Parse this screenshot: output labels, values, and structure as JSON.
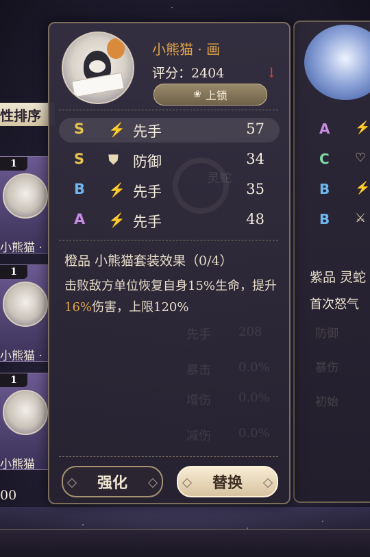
{
  "popup": {
    "title": "小熊猫 · 画",
    "score_label": "评分：2404",
    "lock_label": "上锁",
    "stats": [
      {
        "grade": "S",
        "grade_color": "#e7c44e",
        "icon": "speed-icon",
        "glyph": "⚡",
        "name": "先手",
        "value": "57",
        "highlight": true
      },
      {
        "grade": "S",
        "grade_color": "#e7c44e",
        "icon": "shield-icon",
        "glyph": "⛊",
        "name": "防御",
        "value": "34",
        "highlight": false
      },
      {
        "grade": "B",
        "grade_color": "#6fb6ee",
        "icon": "speed-icon",
        "glyph": "⚡",
        "name": "先手",
        "value": "35",
        "highlight": false
      },
      {
        "grade": "A",
        "grade_color": "#c98be3",
        "icon": "speed-icon",
        "glyph": "⚡",
        "name": "先手",
        "value": "48",
        "highlight": false
      }
    ],
    "set_title": "橙品 小熊猫套装效果（0/4）",
    "set_desc_part1": "击败敌方单位恢复自身15%生命，提升",
    "set_desc_highlight": "16%",
    "set_desc_part2": "伤害，上限120%",
    "ghost_texts": [
      "灵蛇",
      "先手",
      "208",
      "暴击",
      "0.0%",
      "增伤",
      "0.0%",
      "减伤",
      "0.0%"
    ],
    "enhance_label": "强化",
    "replace_label": "替换"
  },
  "left_list": {
    "sort_label": "性排序",
    "cards": [
      {
        "badge": "1",
        "name": "小熊猫 ·"
      },
      {
        "badge": "1",
        "name": "小熊猫 ·"
      },
      {
        "badge": "1",
        "name": "小熊猫"
      }
    ],
    "bottom_value": "00"
  },
  "right_card": {
    "rows": [
      {
        "grade": "A",
        "color": "#c98be3",
        "glyph": "⚡",
        "icon": "speed-icon"
      },
      {
        "grade": "C",
        "color": "#7fd9a0",
        "glyph": "♡",
        "icon": "heart-icon"
      },
      {
        "grade": "B",
        "color": "#6fb6ee",
        "glyph": "⚡",
        "icon": "speed-icon"
      },
      {
        "grade": "B",
        "color": "#6fb6ee",
        "glyph": "⚔",
        "icon": "sword-icon"
      }
    ],
    "set_title": "紫品 灵蛇",
    "desc": "首次怒气",
    "ghost_texts": [
      "防御",
      "暴伤",
      "初始"
    ]
  },
  "colors": {
    "accent_gold": "#e0a446",
    "down_arrow": "#d9443a"
  }
}
